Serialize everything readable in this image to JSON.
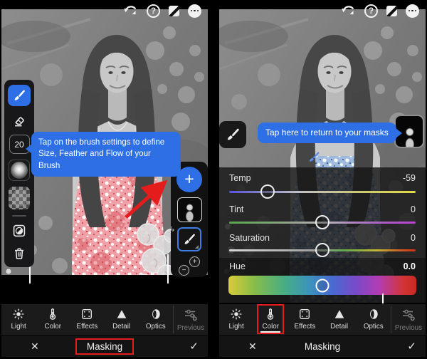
{
  "glyphs": {
    "help": "?",
    "close": "✕",
    "check": "✓",
    "plus": "+",
    "minus": "−",
    "branch": "↳"
  },
  "left_panel": {
    "tooltip_lines": [
      "Tap on the brush settings to define",
      "Size, Feather and Flow of your",
      "Brush"
    ],
    "brush_size": "20",
    "masking_label": "Masking"
  },
  "right_panel": {
    "tooltip": "Tap here to return to your masks",
    "masking_label": "Masking",
    "sliders": [
      {
        "label": "Temp",
        "value": "-59",
        "knob_pct": 20.5
      },
      {
        "label": "Tint",
        "value": "0",
        "knob_pct": 50
      },
      {
        "label": "Saturation",
        "value": "0",
        "knob_pct": 50
      },
      {
        "label": "Hue",
        "value": "0.0",
        "knob_pct": 50
      }
    ]
  },
  "toolbar": {
    "items": [
      {
        "label": "Light"
      },
      {
        "label": "Color"
      },
      {
        "label": "Effects"
      },
      {
        "label": "Detail"
      },
      {
        "label": "Optics"
      },
      {
        "label": "Previous"
      }
    ],
    "selected_right": "Color"
  },
  "colors": {
    "accent_blue": "#2e6fe6",
    "highlight_red": "#e41c1c"
  }
}
